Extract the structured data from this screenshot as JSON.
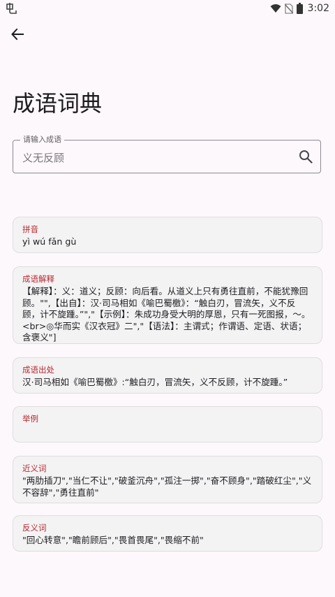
{
  "status_bar": {
    "time": "3:02",
    "icons": [
      "app-notification-icon",
      "wifi-icon",
      "no-sim-icon",
      "battery-icon"
    ]
  },
  "header": {
    "back_icon": "arrow-back-icon",
    "title": "成语词典"
  },
  "search": {
    "label": "请输入成语",
    "value": "义无反顾",
    "icon": "search-icon"
  },
  "cards": {
    "pinyin": {
      "title": "拼音",
      "content": "yì wú fǎn gù"
    },
    "explanation": {
      "title": "成语解释",
      "content": "【解释】：义：道义；反顾：向后看。从道义上只有勇往直前，不能犹豫回顾。\"\",【出自】：汉·司马相如《喻巴蜀檄》：“触白刃，冒流矢，义不反顾，计不旋踵。”\",\"【示例】：朱成功身受大明的厚恩，只有一死图报，～。<br>◎华而实《汉衣冠》二\",\"【语法】：主谓式；作谓语、定语、状语；含褒义\"]"
    },
    "source": {
      "title": "成语出处",
      "content": "汉·司马相如《喻巴蜀檄》:“触白刃，冒流矢，义不反顾，计不旋踵。”"
    },
    "example": {
      "title": "举例",
      "content": ""
    },
    "synonyms": {
      "title": "近义词",
      "content": "\"两肋插刀\",\"当仁不让\",\"破釜沉舟\",\"孤注一掷\",\"奋不顾身\",\"踏破红尘\",\"义不容辞\",\"勇往直前\""
    },
    "antonyms": {
      "title": "反义词",
      "content": "\"回心转意\",\"瞻前顾后\",\"畏首畏尾\",\"畏缩不前\""
    }
  },
  "colors": {
    "background": "#fdf8fb",
    "card_background": "#f4f3f4",
    "card_title": "#b4292f",
    "text": "#1c1b1f"
  }
}
